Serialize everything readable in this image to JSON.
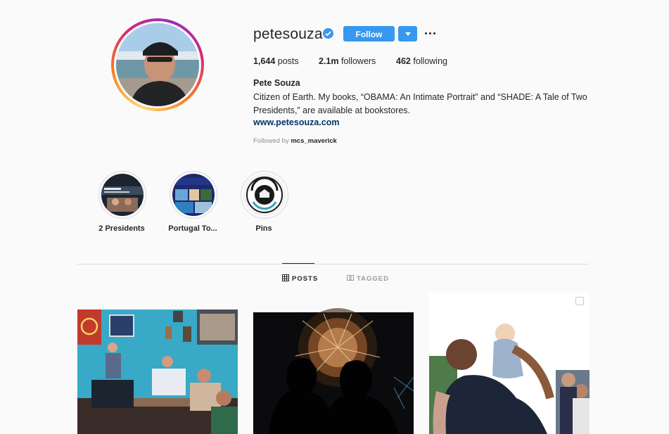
{
  "profile": {
    "username": "petesouza",
    "full_name": "Pete Souza",
    "bio": "Citizen of Earth. My books, “OBAMA: An Intimate Portrait” and “SHADE: A Tale of Two Presidents,” are available at bookstores.",
    "website": "www.petesouza.com",
    "followed_by_prefix": "Followed by",
    "followed_by_user": "mcs_maverick"
  },
  "actions": {
    "follow_label": "Follow"
  },
  "stats": {
    "posts_count": "1,644",
    "posts_label": "posts",
    "followers_count": "2.1m",
    "followers_label": "followers",
    "following_count": "462",
    "following_label": "following"
  },
  "highlights": [
    {
      "label": "2 Presidents"
    },
    {
      "label": "Portugal To..."
    },
    {
      "label": "Pins"
    }
  ],
  "tabs": {
    "posts_label": "POSTS",
    "tagged_label": "TAGGED"
  },
  "colors": {
    "accent": "#3897f0",
    "link": "#003569",
    "muted": "#8e8e8e"
  }
}
